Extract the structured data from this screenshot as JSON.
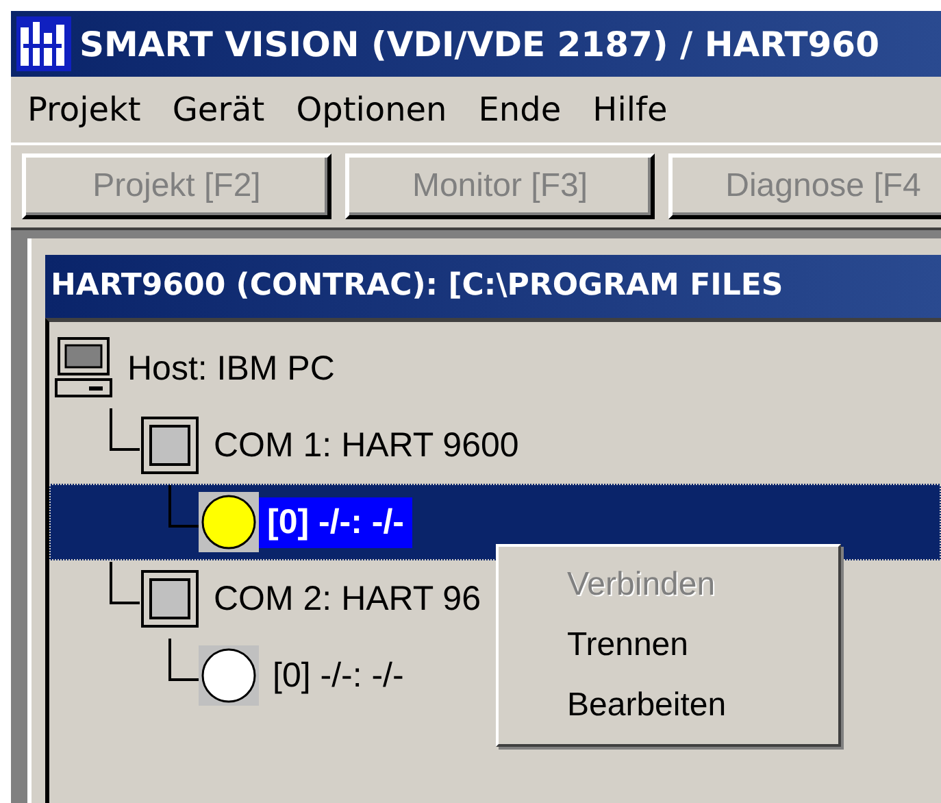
{
  "window": {
    "title": "SMART VISION (VDI/VDE 2187) / HART960"
  },
  "menu": [
    "Projekt",
    "Gerät",
    "Optionen",
    "Ende",
    "Hilfe"
  ],
  "toolbar": [
    {
      "label": "Projekt [F2]",
      "disabled": true
    },
    {
      "label": "Monitor [F3]",
      "disabled": true
    },
    {
      "label": "Diagnose [F4",
      "disabled": true
    }
  ],
  "child_window": {
    "title": "HART9600 (CONTRAC): [C:\\PROGRAM FILES",
    "tree": [
      {
        "kind": "host",
        "label": "Host: IBM PC",
        "selected": false,
        "children": [
          {
            "kind": "port",
            "label": "COM 1: HART 9600",
            "selected": false,
            "children": [
              {
                "kind": "device",
                "label": "[0] -/-: -/-",
                "selected": true,
                "color": "#ffff00"
              }
            ]
          },
          {
            "kind": "port",
            "label": "COM 2: HART 96",
            "selected": false,
            "children": [
              {
                "kind": "device",
                "label": "[0] -/-: -/-",
                "selected": false,
                "color": "#ffffff"
              }
            ]
          }
        ]
      }
    ]
  },
  "context_menu": [
    {
      "label": "Verbinden",
      "disabled": true
    },
    {
      "label": "Trennen",
      "disabled": false
    },
    {
      "label": "Bearbeiten",
      "disabled": false
    }
  ]
}
